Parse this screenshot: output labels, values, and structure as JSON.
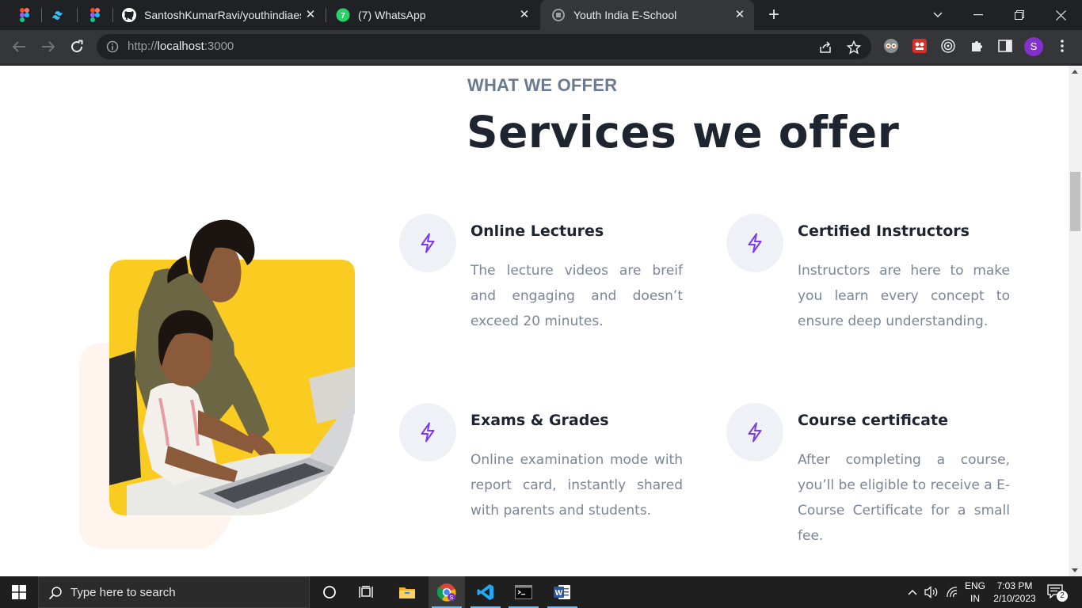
{
  "browser": {
    "tabs": [
      {
        "title": "",
        "icon": "figma-icon"
      },
      {
        "title": "",
        "icon": "tailwind-icon"
      },
      {
        "title": "",
        "icon": "figma-icon"
      },
      {
        "title": "SantoshKumarRavi/youthindiaesc",
        "icon": "github-icon"
      },
      {
        "title": "(7) WhatsApp",
        "icon": "whatsapp-icon"
      },
      {
        "title": "Youth India E-School",
        "icon": "site-favicon-icon",
        "active": true
      }
    ],
    "url_scheme": "http://",
    "url_host": "localhost",
    "url_port": ":3000",
    "profile_initial": "S"
  },
  "section": {
    "eyebrow": "WHAT WE OFFER",
    "heading": "Services we offer",
    "accent_color": "#7c3aed",
    "illustration_bg": "#facc22",
    "services": [
      {
        "title": "Online Lectures",
        "description": "The lecture videos are breif and engaging and doesn’t exceed 20 minutes."
      },
      {
        "title": "Certified Instructors",
        "description": "Instructors are here to make you learn every concept to ensure deep understanding."
      },
      {
        "title": "Exams & Grades",
        "description": "Online examination mode with report card, instantly shared with parents and students."
      },
      {
        "title": "Course certificate",
        "description": "After completing a course, you’ll be eligible to receive a E-Course Certificate for a small fee."
      }
    ]
  },
  "taskbar": {
    "search_placeholder": "Type here to search",
    "language": "ENG",
    "region": "IN",
    "time": "7:03 PM",
    "date": "2/10/2023",
    "notification_count": "2"
  }
}
